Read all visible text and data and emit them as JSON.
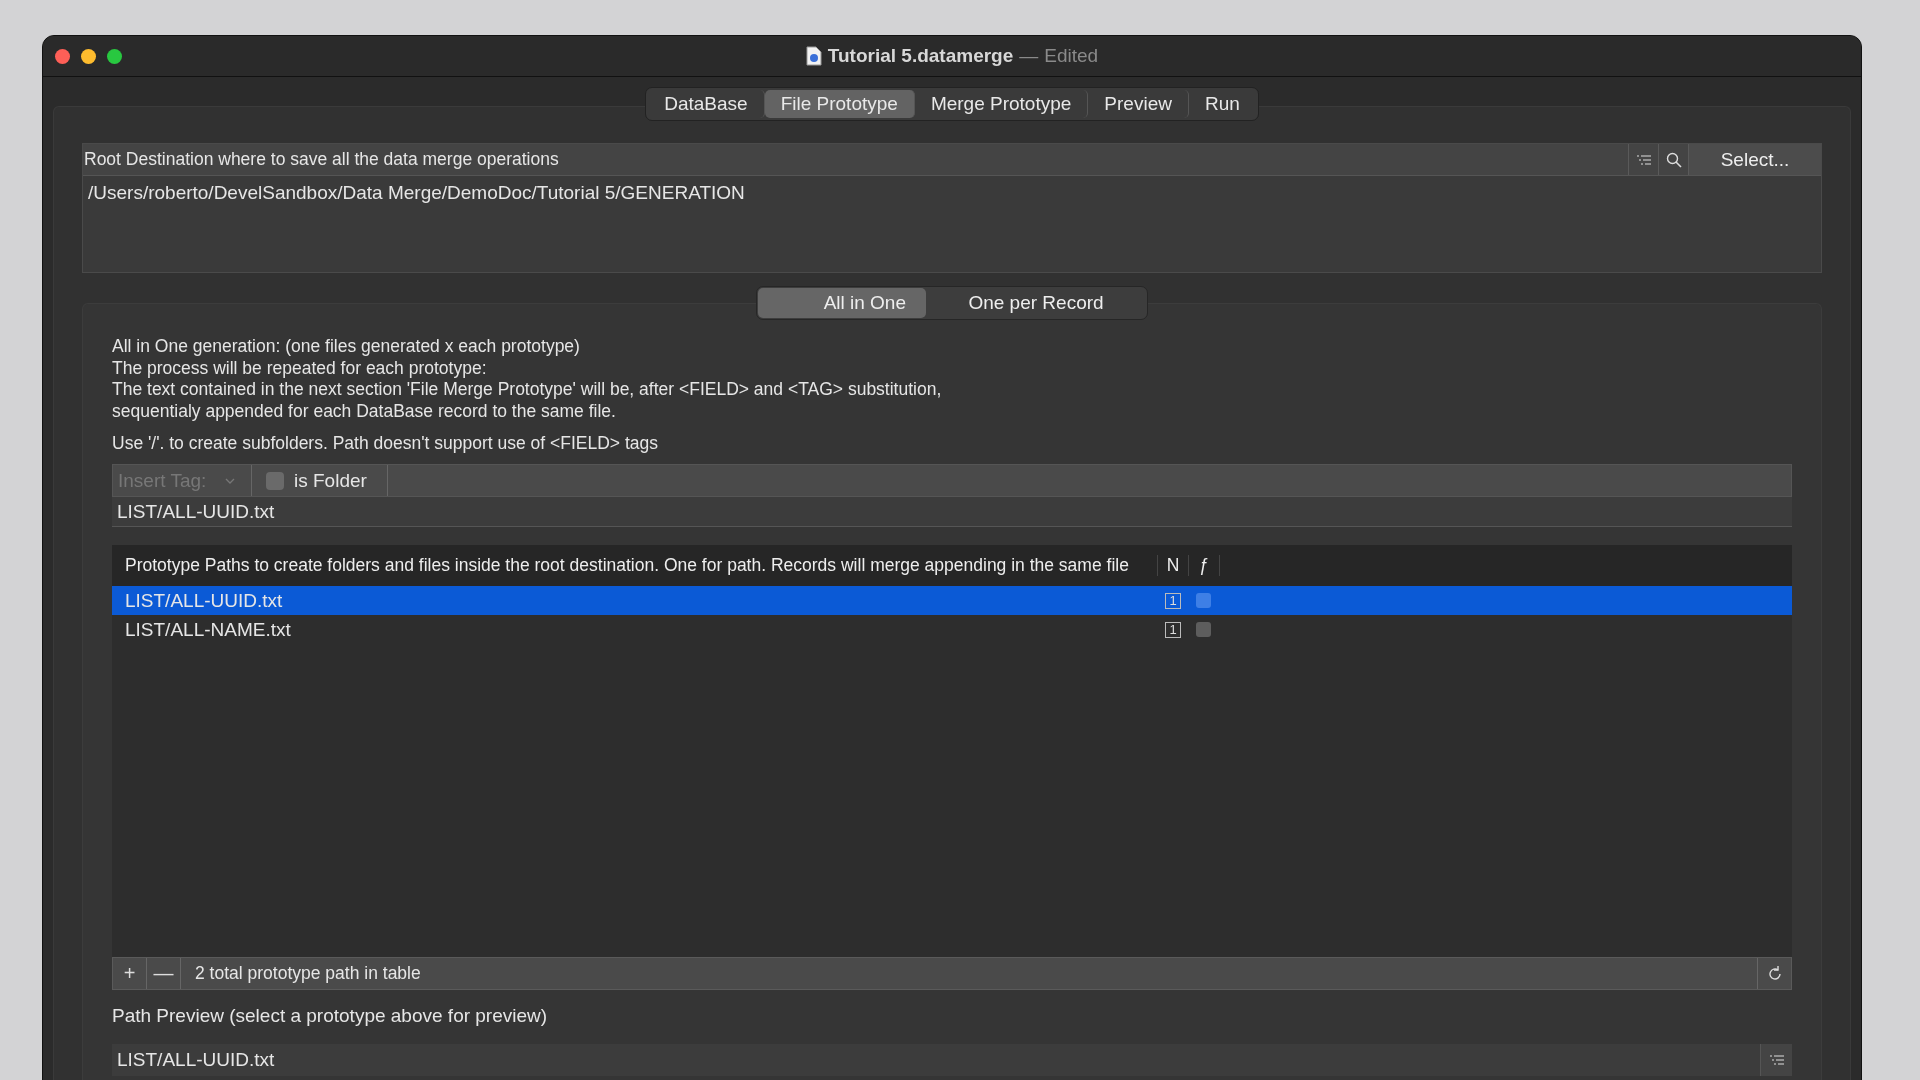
{
  "window": {
    "title": "Tutorial 5.datamerge",
    "separator": "—",
    "subtitle": "Edited"
  },
  "tabs": [
    {
      "label": "DataBase",
      "selected": false
    },
    {
      "label": "File Prototype",
      "selected": true
    },
    {
      "label": "Merge Prototype",
      "selected": false
    },
    {
      "label": "Preview",
      "selected": false
    },
    {
      "label": "Run",
      "selected": false
    }
  ],
  "root_destination": {
    "label": "Root Destination where to save all the data merge operations",
    "select_button": "Select...",
    "path": "/Users/roberto/DevelSandbox/Data Merge/DemoDoc/Tutorial 5/GENERATION"
  },
  "modes": [
    {
      "label": "All in One",
      "selected": true
    },
    {
      "label": "One per Record",
      "selected": false
    }
  ],
  "description": [
    "All in One generation: (one files generated x each prototype)",
    "The process will be repeated for each prototype:",
    "The text contained in the next section 'File Merge Prototype' will be, after <FIELD> and <TAG> substitution,",
    "sequentialy appended for each DataBase record to the same file."
  ],
  "hint": "Use '/'. to create subfolders. Path doesn't support use of <FIELD> tags",
  "insert_tag": {
    "placeholder": "Insert Tag:"
  },
  "is_folder": {
    "label": "is Folder",
    "checked": false
  },
  "path_field": {
    "value": "LIST/ALL-UUID.txt"
  },
  "table": {
    "columns": [
      "Prototype Paths to create folders and  files inside the root destination. One for path. Records will merge appending in the same file",
      "N",
      "ƒ"
    ],
    "rows": [
      {
        "path": "LIST/ALL-UUID.txt",
        "n": "1",
        "f_checked": false,
        "selected": true
      },
      {
        "path": "LIST/ALL-NAME.txt",
        "n": "1",
        "f_checked": false,
        "selected": false
      }
    ]
  },
  "footer": {
    "add": "+",
    "remove": "—",
    "status": "2 total prototype path in table"
  },
  "path_preview": {
    "label": "Path Preview (select a prototype above for preview)",
    "value": "LIST/ALL-UUID.txt"
  }
}
